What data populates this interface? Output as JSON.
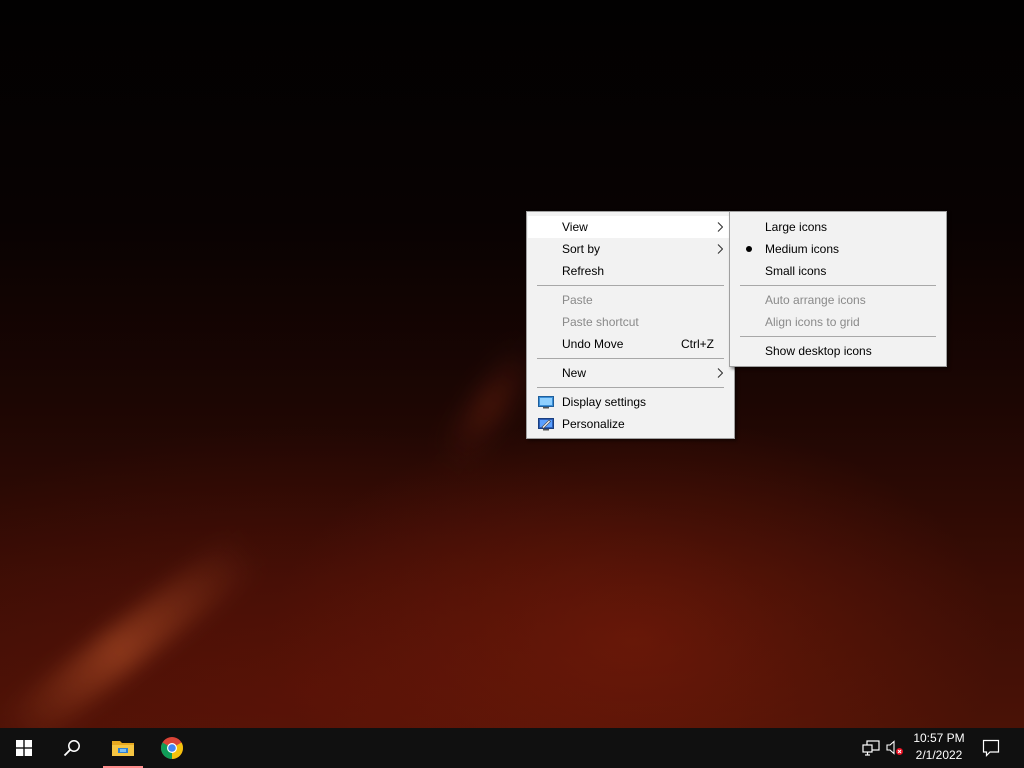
{
  "context_menu": {
    "view": "View",
    "sort_by": "Sort by",
    "refresh": "Refresh",
    "paste": "Paste",
    "paste_shortcut": "Paste shortcut",
    "undo_move": "Undo Move",
    "undo_move_shortcut": "Ctrl+Z",
    "new": "New",
    "display_settings": "Display settings",
    "personalize": "Personalize"
  },
  "view_submenu": {
    "large_icons": "Large icons",
    "medium_icons": "Medium icons",
    "small_icons": "Small icons",
    "auto_arrange_icons": "Auto arrange icons",
    "align_icons_to_grid": "Align icons to grid",
    "show_desktop_icons": "Show desktop icons",
    "selected": "Medium icons"
  },
  "taskbar": {
    "time": "10:57 PM",
    "date": "2/1/2022",
    "pinned_icons": [
      "windows-start-icon",
      "search-icon",
      "file-explorer-icon",
      "chrome-icon"
    ],
    "tray_icons": [
      "network-icon",
      "volume-muted-icon",
      "action-center-icon"
    ]
  },
  "colors": {
    "menu_background": "#f2f2f2",
    "menu_hover": "#ffffff",
    "menu_disabled_text": "#8a8a8a",
    "taskbar": "#101010",
    "active_app_underline": "#ff8c8c"
  }
}
